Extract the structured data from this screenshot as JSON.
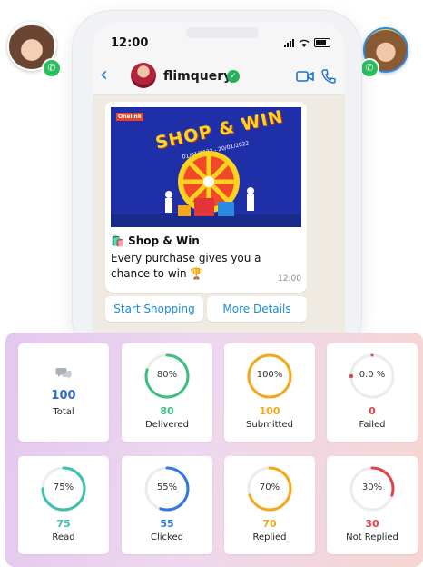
{
  "phone": {
    "time": "12:00",
    "contact_name": "flimquery",
    "verified_icon": "verified-check-icon",
    "back_icon": "chevron-left-icon",
    "video_icon": "video-call-icon",
    "call_icon": "phone-icon"
  },
  "message": {
    "banner_logo": "Onelink",
    "banner_title": "SHOP & WIN",
    "banner_dates": "01/01/2022 - 20/01/2022",
    "title": "🛍️ Shop & Win",
    "body": "Every purchase gives you a chance to win 🏆",
    "time": "12:00"
  },
  "quick_replies": [
    "Start Shopping",
    "More Details"
  ],
  "stats": [
    {
      "id": "total",
      "label": "Total",
      "value": "100",
      "icon": "chat-bubbles-icon",
      "color": "#2f6fd0"
    },
    {
      "id": "delivered",
      "label": "Delivered",
      "value": "80",
      "percent": 80,
      "pct_text": "80%",
      "color": "#3fbf7f"
    },
    {
      "id": "submitted",
      "label": "Submitted",
      "value": "100",
      "percent": 100,
      "pct_text": "100%",
      "color": "#f2a81d"
    },
    {
      "id": "failed",
      "label": "Failed",
      "value": "0",
      "percent": 0,
      "pct_text": "0.0 %",
      "color": "#e0434a"
    },
    {
      "id": "read",
      "label": "Read",
      "value": "75",
      "percent": 75,
      "pct_text": "75%",
      "color": "#3fbfae"
    },
    {
      "id": "clicked",
      "label": "Clicked",
      "value": "55",
      "percent": 55,
      "pct_text": "55%",
      "color": "#2f7ae0"
    },
    {
      "id": "replied",
      "label": "Replied",
      "value": "70",
      "percent": 70,
      "pct_text": "70%",
      "color": "#f2a81d"
    },
    {
      "id": "not_replied",
      "label": "Not Replied",
      "value": "30",
      "percent": 30,
      "pct_text": "30%",
      "color": "#e0434a"
    }
  ]
}
